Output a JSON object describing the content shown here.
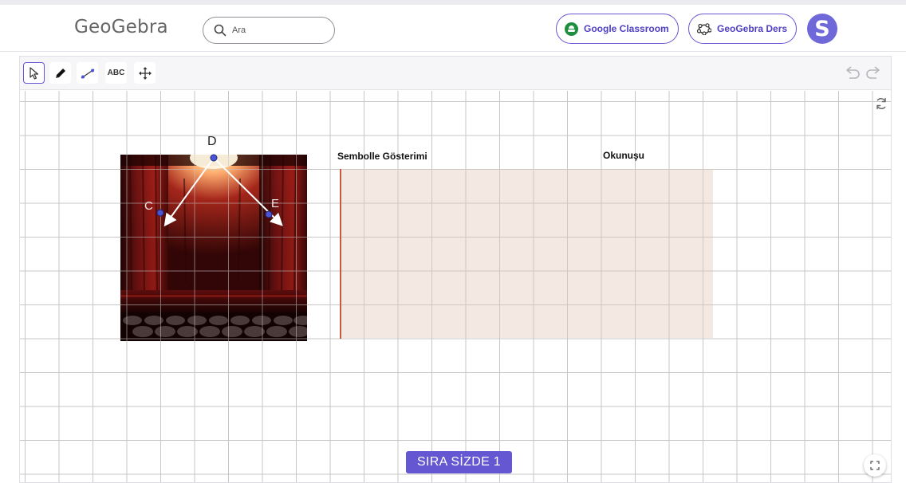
{
  "header": {
    "logo": "GeoGebra",
    "search_placeholder": "Ara",
    "classroom_label": "Google Classroom",
    "ders_label": "GeoGebra Ders",
    "avatar_letter": "S"
  },
  "toolbar": {
    "tools": [
      "move-tool",
      "pen-tool",
      "segment-tool",
      "text-tool",
      "pan-tool"
    ],
    "text_tool_label": "ABC"
  },
  "canvas": {
    "points": {
      "d": "D",
      "c": "C",
      "e": "E"
    },
    "column_header_1": "Sembolle Gösterimi",
    "column_header_2": "Okunuşu",
    "button_label": "SIRA SİZDE 1"
  },
  "colors": {
    "accent": "#6557d2",
    "point": "#4a55d4",
    "table_fill": "#f3e9e3",
    "table_bar": "#c65a3c"
  }
}
